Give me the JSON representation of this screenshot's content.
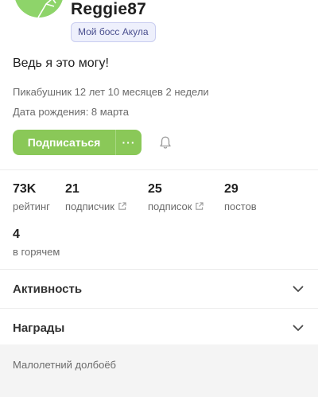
{
  "profile": {
    "username": "Reggie87",
    "badge": "Мой босс Акула",
    "status": "Ведь я это могу!",
    "tenure": "Пикабушник 12 лет 10 месяцев 2 недели",
    "birthday": "Дата рождения: 8 марта"
  },
  "actions": {
    "subscribe_label": "Подписаться",
    "more_label": "···"
  },
  "stats": [
    {
      "value": "73K",
      "label": "рейтинг"
    },
    {
      "value": "21",
      "label": "подписчик"
    },
    {
      "value": "25",
      "label": "подписок"
    },
    {
      "value": "29",
      "label": "постов"
    },
    {
      "value": "4",
      "label": "в горячем"
    }
  ],
  "sections": {
    "activity": "Активность",
    "awards": "Награды"
  },
  "footer": {
    "note": "Малолетний долбоёб"
  },
  "colors": {
    "accent": "#8ac858",
    "avatar": "#8ed46a",
    "badge_bg": "#eef0fc",
    "footer_bg": "#f4f4f4"
  }
}
